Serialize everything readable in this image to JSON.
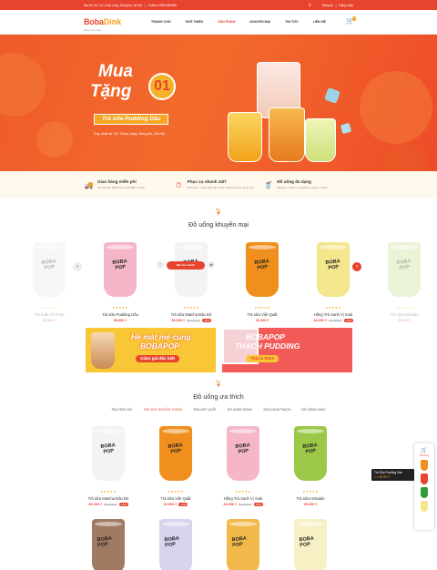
{
  "topbar": {
    "address": "Địa chỉ: Số 147 Chùa Láng, Đống Đa, Hà Nội",
    "hotline": "Hotline: 0966 488 666",
    "login": "Đăng ký",
    "register": "Đăng nhập",
    "search_icon": "search-icon"
  },
  "logo": {
    "part1": "Boba",
    "part2": "Dink",
    "tagline": "Boost Your Day"
  },
  "nav": [
    "Trang chủ",
    "Giới thiệu",
    "Sản phẩm",
    "Khuyến mại",
    "Tin tức",
    "Liên hệ"
  ],
  "nav_active": 2,
  "cart": {
    "count": "0"
  },
  "banner": {
    "line1": "Mua",
    "line2": "Tặng",
    "number": "01",
    "ribbon": "Trà sữa Pudding Dâu",
    "sub": "Duy nhất tại 147 Chùa Láng, Đống Đa, Hà Nội",
    "slides": 3,
    "active_slide": 1
  },
  "features": [
    {
      "title": "Giao hàng miễn phí",
      "desc": "Với các đơn đặt hàng từ 100.000 ₫ trở lên",
      "icon": "delivery-icon"
    },
    {
      "title": "Phục vụ nhanh 24/7",
      "desc": "Mình luôn - Lắng nghe tất cả các ý kiến của mọi người nhé",
      "icon": "clock-icon"
    },
    {
      "title": "Đồ uống đa dạng",
      "desc": "Đồng bộ, matcha, smoothies, yogurts, coffee...",
      "icon": "drink-icon"
    }
  ],
  "promo_section": {
    "title": "Đồ uống khuyến mại"
  },
  "promo_products": [
    {
      "name": "Trà Xoài Hồ Ô Bơ",
      "price": "35.000 ₫",
      "old": "",
      "off": "",
      "color": "#e9e9f2",
      "faded": true
    },
    {
      "name": "Trà sữa Pudding Dâu",
      "price": "35.000 ₫",
      "old": "",
      "off": "",
      "color": "#f5b6c8",
      "faded": false
    },
    {
      "name": "Trà sữa Matcha Đậu Đỏ",
      "price": "30.000 ₫",
      "old": "35.000 ₫",
      "off": "-14%",
      "color": "#f3f3f3",
      "faded": false
    },
    {
      "name": "Trà sữa Việt Quất",
      "price": "42.000 ₫",
      "old": "",
      "off": "",
      "color": "#f08f1e",
      "faded": false
    },
    {
      "name": "Hồng Trà Xanh Vị Xoài",
      "price": "44.000 ₫",
      "old": "51.000 ₫",
      "off": "-14%",
      "color": "#f4e68c",
      "faded": false
    },
    {
      "name": "Trà sữa Hokaido",
      "price": "35.000 ₫",
      "old": "",
      "off": "",
      "color": "#c8e08f",
      "faded": true
    }
  ],
  "quick_view": "Đặt mua nhanh",
  "promo_banners": [
    {
      "title1": "Hè mát mẻ cùng",
      "title2": "BOBAPOP",
      "tag": "Giảm giá đặc biệt"
    },
    {
      "title1": "BOBAPOP",
      "title2": "THẠCH PUDDING",
      "tag": "Thử là thích"
    }
  ],
  "fav_section": {
    "title": "Đồ uống ưa thích"
  },
  "fav_tabs": [
    "Trà trái cây",
    "Trà sữa truyền thống",
    "Trà Việt Quất",
    "Đồ uống nóng",
    "Sữa chua thạch",
    "Đồ uống khác"
  ],
  "fav_tab_active": 1,
  "fav_products": [
    {
      "name": "Trà sữa Matcha Đậu Đỏ",
      "price": "30.000 ₫",
      "old": "35.000 ₫",
      "off": "-14%",
      "color": "#f3f3f3"
    },
    {
      "name": "Trà sữa Việt Quất",
      "price": "42.000 ₫",
      "old": "",
      "off": "-14%",
      "color": "#f08f1e"
    },
    {
      "name": "Hồng Trà Xanh Vị Xoài",
      "price": "44.000 ₫",
      "old": "51.000 ₫",
      "off": "-14%",
      "color": "#f5b6c8"
    },
    {
      "name": "Trà sữa Hokaido",
      "price": "35.000 ₫",
      "old": "",
      "off": "",
      "color": "#9cc84a"
    }
  ],
  "fav_row2_colors": [
    "#a07a62",
    "#d9d3ee",
    "#f2b84a",
    "#f6f0c4"
  ],
  "float_panel": {
    "count": "0",
    "label": "Giỏ hàng"
  },
  "tooltip": {
    "name": "Trà Sữa Pudding Dâu",
    "price": "1 x 35.000 ₫"
  }
}
